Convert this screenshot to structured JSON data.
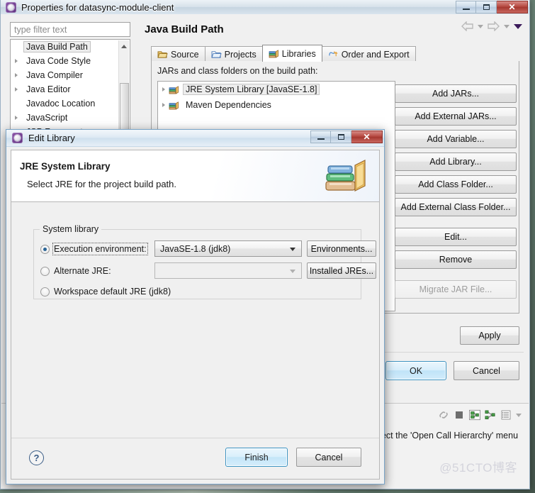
{
  "main_window": {
    "title": "Properties for datasync-module-client",
    "icon": "eclipse-icon",
    "window_buttons": {
      "minimize": "minimize-icon",
      "maximize": "maximize-icon",
      "close": "✕"
    },
    "filter": {
      "placeholder": "type filter text",
      "value": ""
    },
    "page_title": "Java Build Path",
    "tree_items": [
      {
        "label": "Java Build Path",
        "selected": true,
        "expandable": false
      },
      {
        "label": "Java Code Style",
        "selected": false,
        "expandable": true
      },
      {
        "label": "Java Compiler",
        "selected": false,
        "expandable": true
      },
      {
        "label": "Java Editor",
        "selected": false,
        "expandable": true
      },
      {
        "label": "Javadoc Location",
        "selected": false,
        "expandable": false
      },
      {
        "label": "JavaScript",
        "selected": false,
        "expandable": true
      },
      {
        "label": "JSP Fragment",
        "selected": false,
        "expandable": false
      }
    ],
    "nav": {
      "back": "back-arrow-icon",
      "forward": "forward-arrow-icon",
      "menu": "view-menu-icon"
    },
    "tabs": [
      {
        "label": "Source",
        "icon": "source-folder-icon",
        "active": false
      },
      {
        "label": "Projects",
        "icon": "projects-folder-icon",
        "active": false
      },
      {
        "label": "Libraries",
        "icon": "libraries-books-icon",
        "active": true
      },
      {
        "label": "Order and Export",
        "icon": "order-export-icon",
        "active": false
      }
    ],
    "jars_label": "JARs and class folders on the build path:",
    "jars_list": [
      {
        "label": "JRE System Library [JavaSE-1.8]",
        "icon": "library-books-icon",
        "selected": true
      },
      {
        "label": "Maven Dependencies",
        "icon": "library-books-icon",
        "selected": false
      }
    ],
    "side_buttons": [
      {
        "label": "Add JARs...",
        "enabled": true
      },
      {
        "label": "Add External JARs...",
        "enabled": true
      },
      {
        "label": "Add Variable...",
        "enabled": true
      },
      {
        "label": "Add Library...",
        "enabled": true
      },
      {
        "label": "Add Class Folder...",
        "enabled": true
      },
      {
        "label": "Add External Class Folder...",
        "enabled": true,
        "gap_after": true
      },
      {
        "label": "Edit...",
        "enabled": true
      },
      {
        "label": "Remove",
        "enabled": true,
        "gap_after": true
      },
      {
        "label": "Migrate JAR File...",
        "enabled": false
      }
    ],
    "apply_label": "Apply",
    "ok_label": "OK",
    "cancel_label": "Cancel"
  },
  "background_editor": {
    "hint_text": "select the 'Open Call Hierarchy' menu",
    "toolbar_icons": [
      "link-editor-icon",
      "stop-icon",
      "call-hierarchy-icon",
      "hierarchy-icon",
      "list-view-icon",
      "view-menu-icon"
    ],
    "watermark": "@51CTO博客"
  },
  "dialog": {
    "title": "Edit Library",
    "icon": "eclipse-icon",
    "window_buttons": {
      "minimize": "minimize-icon",
      "maximize": "maximize-icon",
      "close": "✕"
    },
    "heading": "JRE System Library",
    "subheading": "Select JRE for the project build path.",
    "header_icon": "books-stack-icon",
    "group_legend": "System library",
    "options": [
      {
        "label": "Execution environment:",
        "mnemonic_index": 1,
        "selected": true,
        "combo_value": "JavaSE-1.8 (jdk8)",
        "combo_enabled": true,
        "button_label": "Environments...",
        "button_mnemonic_index": 6
      },
      {
        "label": "Alternate JRE:",
        "mnemonic_index": 10,
        "selected": false,
        "combo_value": "",
        "combo_enabled": false,
        "button_label": "Installed JREs...",
        "button_mnemonic_index": 0
      },
      {
        "label": "Workspace default JRE (jdk8)",
        "mnemonic_index": 10,
        "selected": false
      }
    ],
    "help_icon": "?",
    "finish_label": "Finish",
    "cancel_label": "Cancel"
  },
  "colors": {
    "accent_blue": "#3c93c2",
    "dialog_border": "#7ba5c8",
    "panel_bg": "#f0f0f0",
    "close_red": "#b64a42",
    "radio_dot": "#2a6496",
    "watermark": "#d4d4dc"
  }
}
